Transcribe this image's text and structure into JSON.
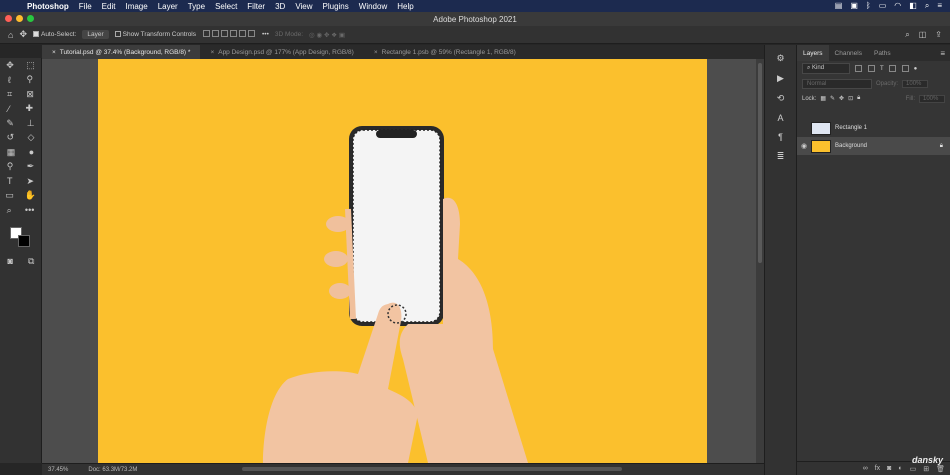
{
  "mac_menu": {
    "app": "Photoshop",
    "items": [
      "File",
      "Edit",
      "Image",
      "Layer",
      "Type",
      "Select",
      "Filter",
      "3D",
      "View",
      "Plugins",
      "Window",
      "Help"
    ]
  },
  "window": {
    "title": "Adobe Photoshop 2021"
  },
  "options": {
    "auto_select_label": "Auto-Select:",
    "auto_select_value": "Layer",
    "transform_label": "Show Transform Controls",
    "mode_3d": "3D Mode:"
  },
  "tabs": [
    {
      "label": "Tutorial.psd @ 37.4% (Background, RGB/8) *",
      "active": true
    },
    {
      "label": "App Design.psd @ 177% (App Design, RGB/8)",
      "active": false
    },
    {
      "label": "Rectangle 1.psb @ 59% (Rectangle 1, RGB/8)",
      "active": false
    }
  ],
  "panel": {
    "tabs": [
      "Layers",
      "Channels",
      "Paths"
    ],
    "filter": "Kind",
    "blend_mode": "Normal",
    "opacity_label": "Opacity:",
    "opacity_value": "100%",
    "lock_label": "Lock:",
    "fill_label": "Fill:",
    "fill_value": "100%",
    "layers": [
      {
        "name": "Rectangle 1",
        "selected": false,
        "visible": false
      },
      {
        "name": "Background",
        "selected": true,
        "visible": true
      }
    ]
  },
  "status": {
    "zoom": "37.45%",
    "doc": "Doc: 63.3M/73.2M"
  },
  "watermark": "dansky",
  "colors": {
    "canvas": "#fbc02d",
    "fg": "#ffffff",
    "bg": "#000000",
    "menubar": "#1c2a4f"
  }
}
